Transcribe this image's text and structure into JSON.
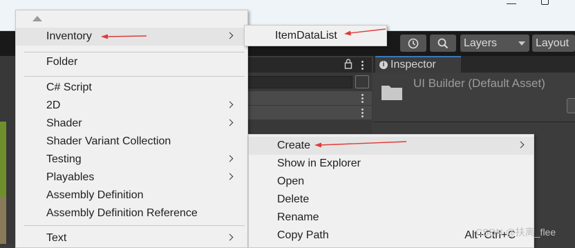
{
  "main_menu": {
    "items": [
      {
        "label": "Inventory",
        "submenu": true,
        "highlighted": true
      },
      {
        "label": "Folder",
        "submenu": false
      },
      {
        "label": "C# Script",
        "submenu": false
      },
      {
        "label": "2D",
        "submenu": true
      },
      {
        "label": "Shader",
        "submenu": true
      },
      {
        "label": "Shader Variant Collection",
        "submenu": false
      },
      {
        "label": "Testing",
        "submenu": true
      },
      {
        "label": "Playables",
        "submenu": true
      },
      {
        "label": "Assembly Definition",
        "submenu": false
      },
      {
        "label": "Assembly Definition Reference",
        "submenu": false
      },
      {
        "label": "Text",
        "submenu": true
      }
    ]
  },
  "inventory_submenu": {
    "items": [
      {
        "label": "ItemDataList"
      }
    ]
  },
  "context_menu": {
    "items": [
      {
        "label": "Create",
        "submenu": true,
        "highlighted": true
      },
      {
        "label": "Show in Explorer"
      },
      {
        "label": "Open"
      },
      {
        "label": "Delete"
      },
      {
        "label": "Rename"
      },
      {
        "label": "Copy Path",
        "shortcut": "Alt+Ctrl+C"
      }
    ]
  },
  "toolbar": {
    "history_icon": "history-icon",
    "search_icon": "search-icon",
    "layers_label": "Layers",
    "layout_label": "Layout"
  },
  "inspector": {
    "tab_label": "Inspector",
    "asset_title": "UI Builder (Default Asset)"
  },
  "watermark": "CSDN @扶离_flee",
  "colors": {
    "menu_bg": "#f0f0f0",
    "highlight": "#e4e4e4",
    "annotation_arrow": "#e03a3a",
    "accent_tab": "#3a79bb"
  }
}
